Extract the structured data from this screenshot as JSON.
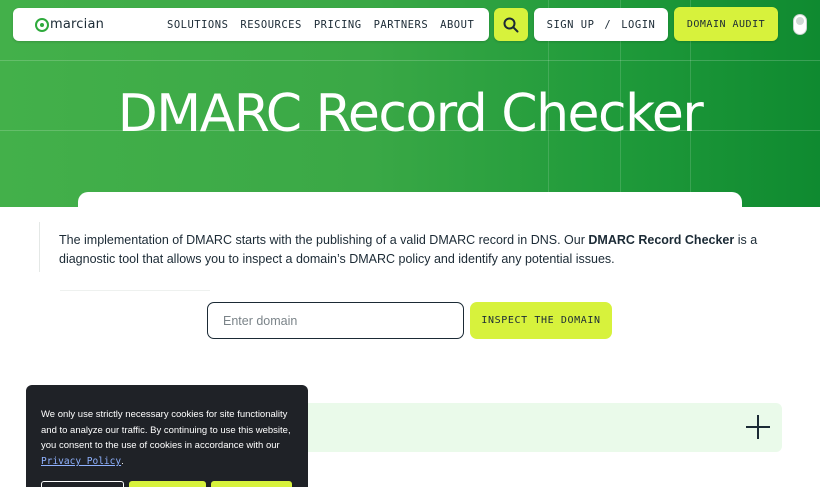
{
  "nav": {
    "logo": "marcian",
    "links": [
      "SOLUTIONS",
      "RESOURCES",
      "PRICING",
      "PARTNERS",
      "ABOUT"
    ],
    "sign_up": "SIGN UP",
    "separator": "/",
    "login": "LOGIN",
    "domain_audit": "DOMAIN AUDIT"
  },
  "hero": {
    "title": "DMARC Record Checker"
  },
  "intro": {
    "text_before": "The implementation of DMARC starts with the publishing of a valid DMARC record in DNS. Our ",
    "bold": "DMARC Record Checker",
    "text_after": " is a diagnostic tool that allows you to inspect a domain’s DMARC policy and identify any potential issues."
  },
  "form": {
    "placeholder": "Enter domain",
    "value": "",
    "button": "INSPECT THE DOMAIN"
  },
  "cookie": {
    "text": "We only use strictly necessary cookies for site functionality and to analyze our traffic. By continuing to use this website, you consent to the use of cookies in accordance with our ",
    "link": "Privacy Policy",
    "suffix": "."
  },
  "colors": {
    "accent": "#d7f23c",
    "hero_green": "#3aa846",
    "text": "#1b2a35"
  }
}
